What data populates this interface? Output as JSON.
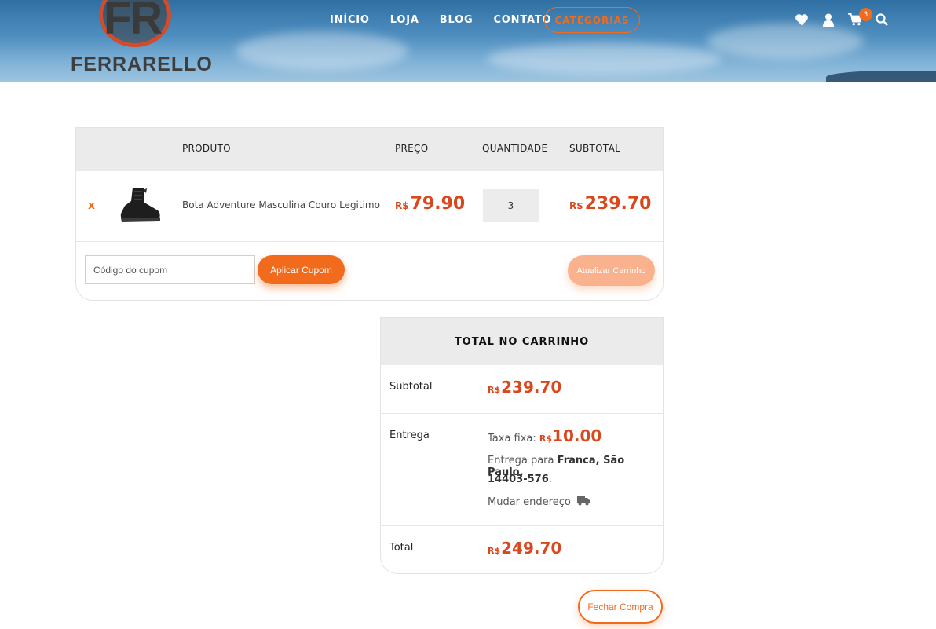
{
  "brand": {
    "logo_initials": "FR",
    "logo_name": "FERRARELLO"
  },
  "nav": {
    "items": [
      "INÍCIO",
      "LOJA",
      "BLOG",
      "CONTATO"
    ],
    "categories_button": "CATEGORIAS"
  },
  "header_icons": {
    "wishlist": "heart-icon",
    "account": "user-icon",
    "cart": "cart-icon",
    "search": "search-icon",
    "cart_count": "3"
  },
  "cart": {
    "headers": {
      "product": "PRODUTO",
      "price": "PREÇO",
      "quantity": "QUANTIDADE",
      "subtotal": "SUBTOTAL"
    },
    "items": [
      {
        "remove": "x",
        "name": "Bota Adventure Masculina Couro Legitimo",
        "currency": "R$",
        "price": "79.90",
        "quantity": "3",
        "subtotal": "239.70"
      }
    ],
    "coupon_placeholder": "Código do cupom",
    "apply_coupon_label": "Aplicar Cupom",
    "update_cart_label": "Atualizar Carrinho"
  },
  "totals": {
    "title": "TOTAL NO CARRINHO",
    "subtotal_label": "Subtotal",
    "subtotal_value": "239.70",
    "shipping_label": "Entrega",
    "flat_rate_label": "Taxa fixa:",
    "flat_rate_value": "10.00",
    "ship_to_prefix": "Entrega para",
    "ship_to_address": "Franca, São Paulo,",
    "ship_to_zip": "14403-576",
    "change_address_label": "Mudar endereço",
    "total_label": "Total",
    "total_value": "249.70",
    "currency": "R$"
  },
  "checkout_label": "Fechar Compra",
  "colors": {
    "accent": "#f26a1b",
    "price": "#d9471c",
    "header_bg": "#ebebeb"
  }
}
